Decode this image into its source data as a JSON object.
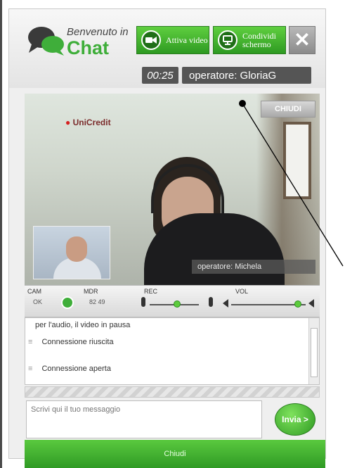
{
  "header": {
    "welcome_text": "Benvenuto in",
    "chat_text": "Chat",
    "video_button": "Attiva video",
    "share_button": "Condividi schermo",
    "close_button": "✕",
    "timer": "00:25",
    "operator": "operatore: GloriaG",
    "icons": {
      "video": "video-camera-icon",
      "share": "monitor-icon",
      "close": "close-icon"
    },
    "colors": {
      "brand_green": "#3fae3a",
      "button_green": "#2e9a22"
    }
  },
  "video": {
    "top_button": "CHIUDI",
    "bank_logo": "UniCredit",
    "label": "operatore: Michela"
  },
  "controls": {
    "cam_label": "CAM",
    "cam_value": "OK",
    "mdr_label": "MDR",
    "mdr_value": "82 49",
    "rec_label": "REC",
    "vol_label": "VOL",
    "mic_level": 0.55,
    "vol_level": 0.9
  },
  "messages": {
    "items": [
      {
        "text": "per l'audio, il video in pausa"
      },
      {
        "text": "Connessione riuscita"
      },
      {
        "text": "Connessione aperta"
      }
    ]
  },
  "input": {
    "placeholder": "Scrivi qui il tuo messaggio",
    "send_label": "Invia >"
  },
  "footer": {
    "label": "Chiudi"
  }
}
